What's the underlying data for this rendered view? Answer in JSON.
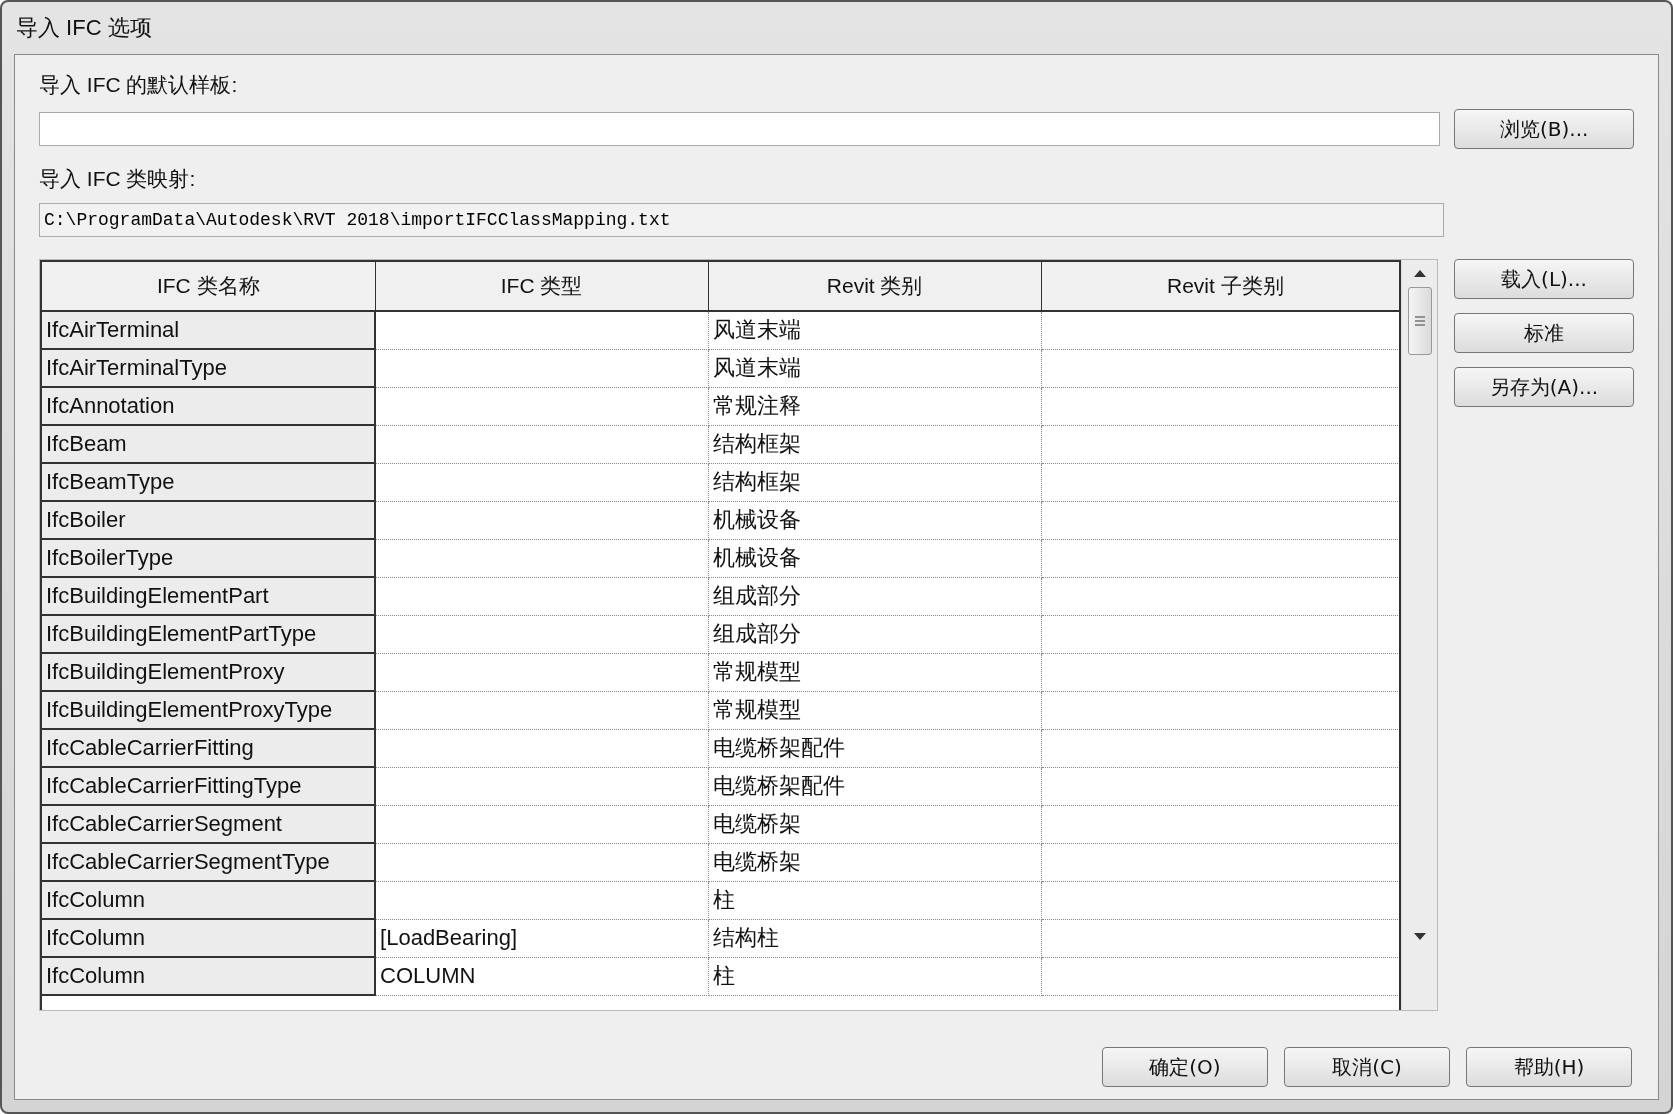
{
  "window": {
    "title": "导入 IFC 选项"
  },
  "template": {
    "label": "导入 IFC 的默认样板:",
    "browse_button": "浏览(B)..."
  },
  "mapping": {
    "label": "导入 IFC 类映射:",
    "value": "C:\\ProgramData\\Autodesk\\RVT 2018\\importIFCClassMapping.txt"
  },
  "table": {
    "columns": [
      "IFC 类名称",
      "IFC 类型",
      "Revit 类别",
      "Revit 子类别"
    ],
    "rows": [
      [
        "IfcAirTerminal",
        "",
        "风道末端",
        ""
      ],
      [
        "IfcAirTerminalType",
        "",
        "风道末端",
        ""
      ],
      [
        "IfcAnnotation",
        "",
        "常规注释",
        ""
      ],
      [
        "IfcBeam",
        "",
        "结构框架",
        ""
      ],
      [
        "IfcBeamType",
        "",
        "结构框架",
        ""
      ],
      [
        "IfcBoiler",
        "",
        "机械设备",
        ""
      ],
      [
        "IfcBoilerType",
        "",
        "机械设备",
        ""
      ],
      [
        "IfcBuildingElementPart",
        "",
        "组成部分",
        ""
      ],
      [
        "IfcBuildingElementPartType",
        "",
        "组成部分",
        ""
      ],
      [
        "IfcBuildingElementProxy",
        "",
        "常规模型",
        ""
      ],
      [
        "IfcBuildingElementProxyType",
        "",
        "常规模型",
        ""
      ],
      [
        "IfcCableCarrierFitting",
        "",
        "电缆桥架配件",
        ""
      ],
      [
        "IfcCableCarrierFittingType",
        "",
        "电缆桥架配件",
        ""
      ],
      [
        "IfcCableCarrierSegment",
        "",
        "电缆桥架",
        ""
      ],
      [
        "IfcCableCarrierSegmentType",
        "",
        "电缆桥架",
        ""
      ],
      [
        "IfcColumn",
        "",
        "柱",
        ""
      ],
      [
        "IfcColumn",
        "[LoadBearing]",
        "结构柱",
        ""
      ],
      [
        "IfcColumn",
        "COLUMN",
        "柱",
        ""
      ]
    ]
  },
  "side_buttons": [
    "载入(L)...",
    "标准",
    "另存为(A)..."
  ],
  "buttons": [
    "确定(O)",
    "取消(C)",
    "帮助(H)"
  ]
}
